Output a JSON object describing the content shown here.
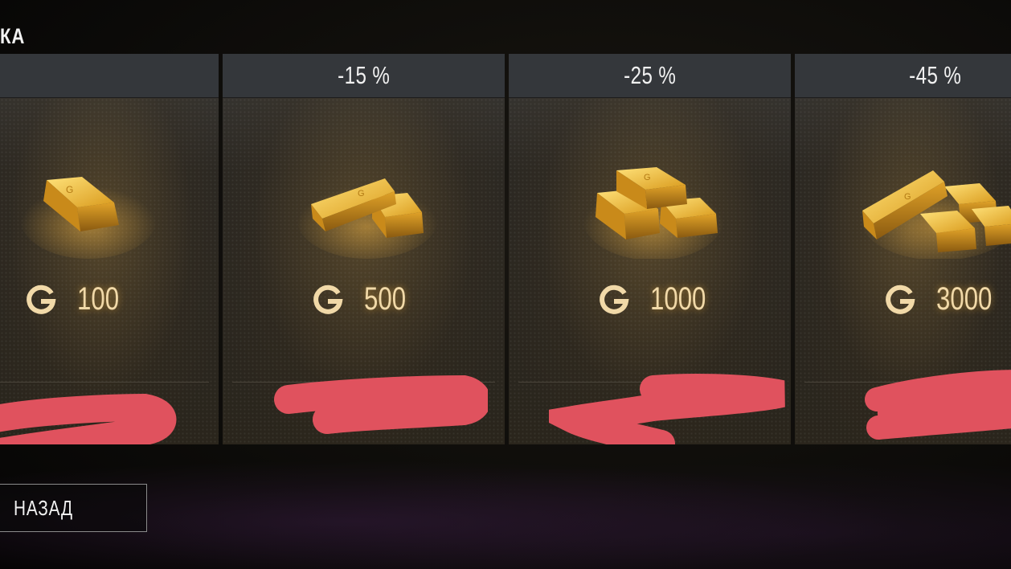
{
  "page": {
    "title": "КА"
  },
  "offers": [
    {
      "discount": "",
      "amount": "100"
    },
    {
      "discount": "-15 %",
      "amount": "500"
    },
    {
      "discount": "-25 %",
      "amount": "1000"
    },
    {
      "discount": "-45 %",
      "amount": "3000"
    }
  ],
  "currency": {
    "icon": "gold-g-icon",
    "color": "#f1d9a8"
  },
  "footer": {
    "back_label": "НАЗАД"
  },
  "colors": {
    "redaction": "#e0525e",
    "header": "#34373b"
  }
}
